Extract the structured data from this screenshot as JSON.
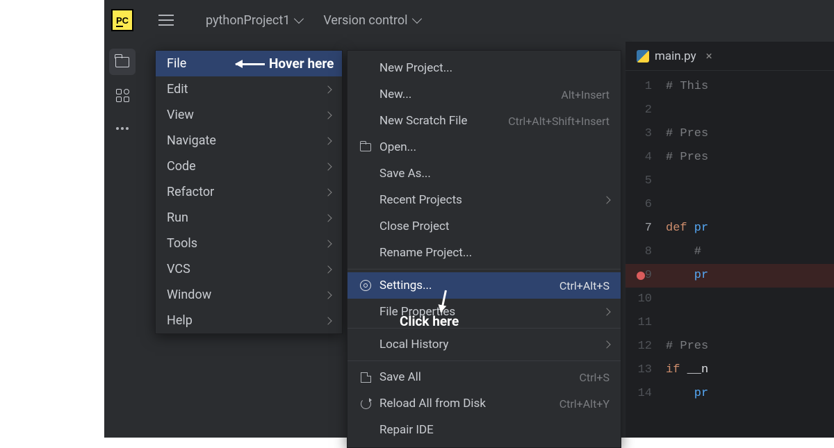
{
  "toolbar": {
    "logo_text": "PC",
    "project_name": "pythonProject1",
    "version_control": "Version control"
  },
  "menu1": {
    "items": [
      {
        "label": "File",
        "selected": true,
        "submenu": false
      },
      {
        "label": "Edit",
        "submenu": true
      },
      {
        "label": "View",
        "submenu": true
      },
      {
        "label": "Navigate",
        "submenu": true
      },
      {
        "label": "Code",
        "submenu": true
      },
      {
        "label": "Refactor",
        "submenu": true
      },
      {
        "label": "Run",
        "submenu": true
      },
      {
        "label": "Tools",
        "submenu": true
      },
      {
        "label": "VCS",
        "submenu": true
      },
      {
        "label": "Window",
        "submenu": true
      },
      {
        "label": "Help",
        "submenu": true
      }
    ]
  },
  "menu2": {
    "items": [
      {
        "label": "New Project..."
      },
      {
        "label": "New...",
        "shortcut": "Alt+Insert"
      },
      {
        "label": "New Scratch File",
        "shortcut": "Ctrl+Alt+Shift+Insert"
      },
      {
        "label": "Open...",
        "icon": "folder"
      },
      {
        "label": "Save As..."
      },
      {
        "label": "Recent Projects",
        "submenu": true
      },
      {
        "label": "Close Project"
      },
      {
        "label": "Rename Project..."
      },
      {
        "sep": true
      },
      {
        "label": "Settings...",
        "icon": "gear",
        "shortcut": "Ctrl+Alt+S",
        "selected": true
      },
      {
        "label": "File Properties",
        "submenu": true
      },
      {
        "sep": true
      },
      {
        "label": "Local History",
        "submenu": true
      },
      {
        "sep": true
      },
      {
        "label": "Save All",
        "icon": "save",
        "shortcut": "Ctrl+S"
      },
      {
        "label": "Reload All from Disk",
        "icon": "reload",
        "shortcut": "Ctrl+Alt+Y"
      },
      {
        "label": "Repair IDE"
      }
    ]
  },
  "editor": {
    "tab_name": "main.py",
    "gutter": [
      "1",
      "2",
      "3",
      "4",
      "5",
      "6",
      "7",
      "8",
      "9",
      "10",
      "11",
      "12",
      "13",
      "14"
    ],
    "breakpoint_line": 9,
    "lines": [
      {
        "c": "# This"
      },
      {
        "c": ""
      },
      {
        "c": "# Pres"
      },
      {
        "c": "# Pres"
      },
      {
        "c": ""
      },
      {
        "c": ""
      },
      {
        "kw": "def",
        "fn": " pr"
      },
      {
        "c": "    # "
      },
      {
        "fn": "    pr",
        "hl": true
      },
      {
        "c": ""
      },
      {
        "c": ""
      },
      {
        "c": "# Pres"
      },
      {
        "kw": "if",
        "c2": " __n"
      },
      {
        "fn": "    pr"
      }
    ]
  },
  "annotations": {
    "hover": "Hover here",
    "click": "Click here"
  }
}
